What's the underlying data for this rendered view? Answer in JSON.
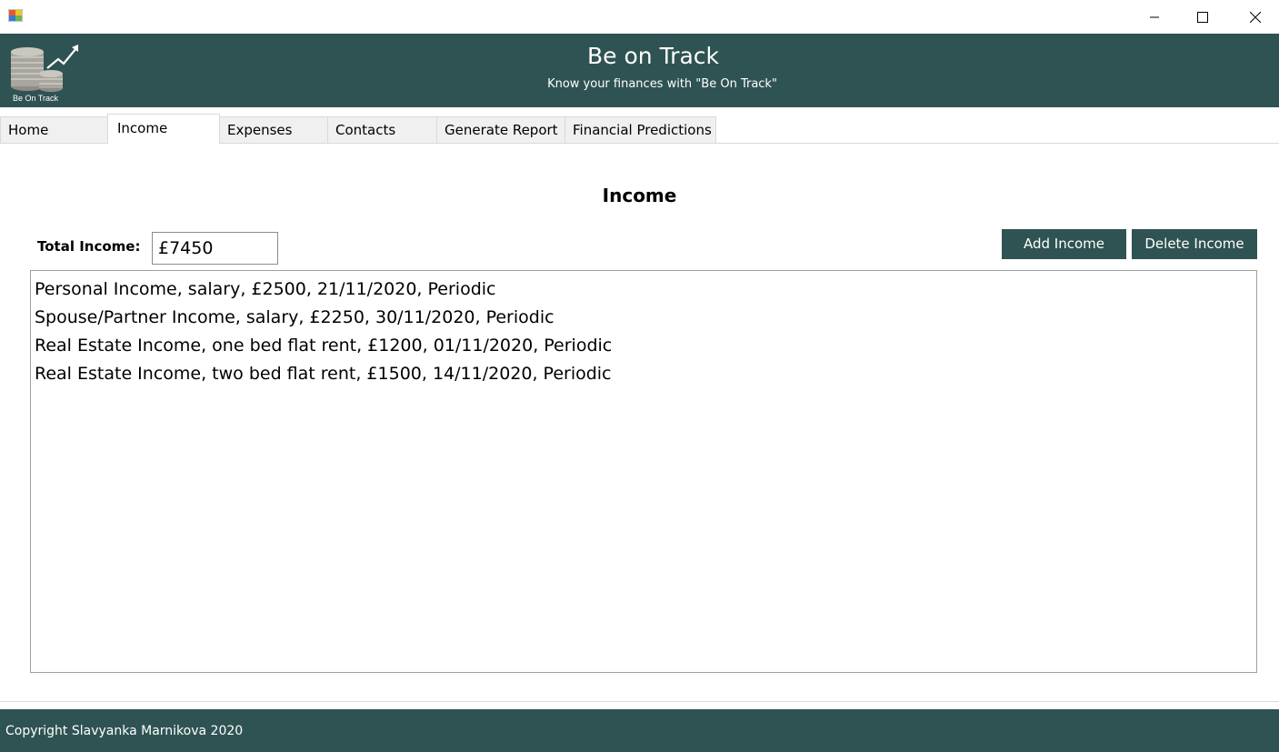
{
  "window": {
    "icons": {
      "app": "app-icon",
      "minimize": "minimize-icon",
      "maximize": "maximize-icon",
      "close": "close-icon"
    }
  },
  "header": {
    "title": "Be on Track",
    "subtitle": "Know your finances with \"Be On Track\"",
    "logo_text": "Be On Track",
    "background_color": "#2f5352"
  },
  "tabs": [
    {
      "label": "Home",
      "active": false
    },
    {
      "label": "Income",
      "active": true
    },
    {
      "label": "Expenses",
      "active": false
    },
    {
      "label": "Contacts",
      "active": false
    },
    {
      "label": "Generate Report",
      "active": false
    },
    {
      "label": "Financial Predictions",
      "active": false
    }
  ],
  "income": {
    "heading": "Income",
    "total_label": "Total Income:",
    "total_value": "£7450",
    "add_button": "Add Income",
    "delete_button": "Delete Income",
    "entries": [
      "Personal Income, salary, £2500, 21/11/2020, Periodic",
      "Spouse/Partner Income, salary, £2250, 30/11/2020, Periodic",
      "Real Estate Income, one bed flat rent, £1200, 01/11/2020, Periodic",
      "Real Estate Income, two bed flat rent, £1500, 14/11/2020, Periodic"
    ]
  },
  "footer": {
    "copyright": "Copyright Slavyanka Marnikova 2020"
  }
}
